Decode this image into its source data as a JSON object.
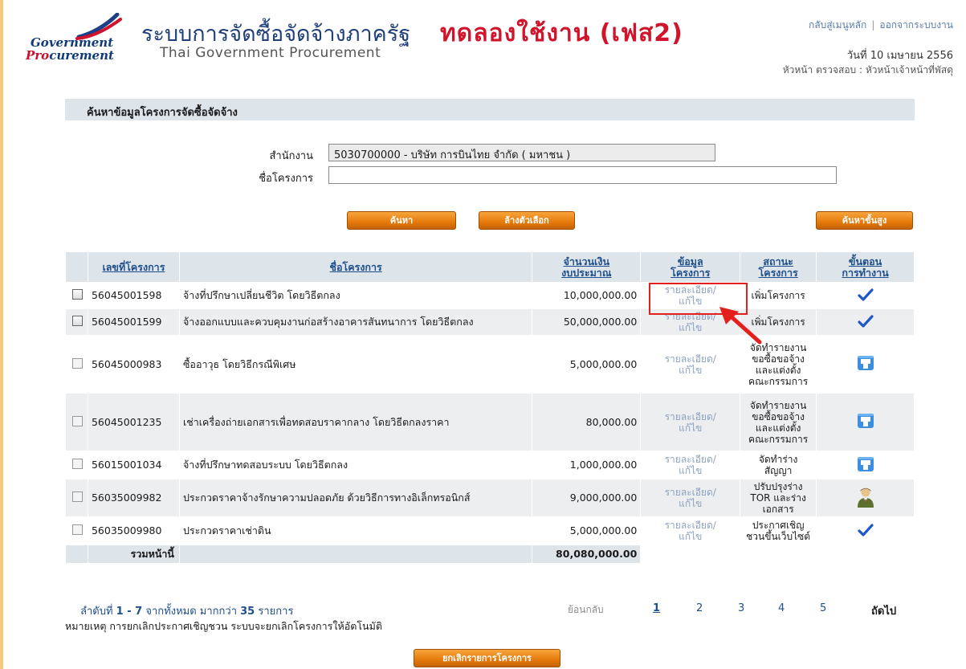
{
  "header": {
    "logo_word_1": "Government",
    "logo_word_2a": "P",
    "logo_word_2b": "ro",
    "logo_word_2c": "curement",
    "title_th": "ระบบการจัดซื้อจัดจ้างภาครัฐ",
    "trial_label": "ทดลองใช้งาน (เฟส2)",
    "subtitle_en": "Thai Government Procurement",
    "link_main_menu": "กลับสู่เมนูหลัก",
    "link_separator": "|",
    "link_logout": "ออกจากระบบงาน",
    "date_text": "วันที่ 10 เมษายน 2556",
    "role_text": "หัวหน้า ตรวจสอบ : หัวหน้าเจ้าหน้าที่พัสดุ"
  },
  "search": {
    "panel_title": "ค้นหาข้อมูลโครงการจัดซื้อจัดจ้าง",
    "office_label": "สำนักงาน",
    "office_value": "5030700000 - บริษัท การบินไทย จำกัด ( มหาชน )",
    "project_name_label": "ชื่อโครงการ",
    "project_name_value": "",
    "search_button": "ค้นหา",
    "clear_button": "ล้างตัวเลือก",
    "advanced_button": "ค้นหาขั้นสูง"
  },
  "table": {
    "columns": {
      "project_no": "เลขที่โครงการ",
      "project_name": "ชื่อโครงการ",
      "budget_line1": "จำนวนเงิน",
      "budget_line2": "งบประมาณ",
      "info_line1": "ข้อมูล",
      "info_line2": "โครงการ",
      "status_line1": "สถานะ",
      "status_line2": "โครงการ",
      "step_line1": "ขั้นตอน",
      "step_line2": "การทำงาน"
    },
    "rows": [
      {
        "no": "56045001598",
        "name": "จ้างที่ปรึกษาเปลี่ยนชีวิต โดยวิธีตกลง",
        "budget": "10,000,000.00",
        "link_line1": "รายละเอียด/",
        "link_line2": "แก้ไข",
        "status": "เพิ่มโครงการ",
        "step_icon": "checkmark-icon"
      },
      {
        "no": "56045001599",
        "name": "จ้างออกแบบและควบคุมงานก่อสร้างอาคารสันทนาการ โดยวิธีตกลง",
        "budget": "50,000,000.00",
        "link_line1": "รายละเอียด/",
        "link_line2": "แก้ไข",
        "status": "เพิ่มโครงการ",
        "step_icon": "checkmark-icon"
      },
      {
        "no": "56045000983",
        "name": "ซื้ออาวุธ โดยวิธีกรณีพิเศษ",
        "budget": "5,000,000.00",
        "link_line1": "รายละเอียด/",
        "link_line2": "แก้ไข",
        "status": "จัดทำรายงานขอซื้อขอจ้างและแต่งตั้งคณะกรรมการ",
        "step_icon": "truck-icon"
      },
      {
        "no": "56045001235",
        "name": "เช่าเครื่องถ่ายเอกสารเพื่อทดสอบราคากลาง โดยวิธีตกลงราคา",
        "budget": "80,000.00",
        "link_line1": "รายละเอียด/",
        "link_line2": "แก้ไข",
        "status": "จัดทำรายงานขอซื้อขอจ้างและแต่งตั้งคณะกรรมการ",
        "step_icon": "truck-icon"
      },
      {
        "no": "56015001034",
        "name": "จ้างที่ปรึกษาทดสอบระบบ โดยวิธีตกลง",
        "budget": "1,000,000.00",
        "link_line1": "รายละเอียด/",
        "link_line2": "แก้ไข",
        "status": "จัดทำร่างสัญญา",
        "step_icon": "truck-icon"
      },
      {
        "no": "56035009982",
        "name": "ประกวดราคาจ้างรักษาความปลอดภัย ด้วยวิธีการทางอิเล็กทรอนิกส์",
        "budget": "9,000,000.00",
        "link_line1": "รายละเอียด/",
        "link_line2": "แก้ไข",
        "status": "ปรับปรุงร่าง TOR และร่างเอกสาร",
        "step_icon": "person-icon"
      },
      {
        "no": "56035009980",
        "name": "ประกวดราคาเช่าดิน",
        "budget": "5,000,000.00",
        "link_line1": "รายละเอียด/",
        "link_line2": "แก้ไข",
        "status": "ประกาศเชิญชวนขึ้นเว็บไซต์",
        "step_icon": "checkmark-icon"
      }
    ],
    "status_lines": [
      [
        "เพิ่มโครงการ"
      ],
      [
        "เพิ่มโครงการ"
      ],
      [
        "จัดทำรายงาน",
        "ขอซื้อขอจ้าง",
        "และแต่งตั้ง",
        "คณะกรรมการ"
      ],
      [
        "จัดทำรายงาน",
        "ขอซื้อขอจ้าง",
        "และแต่งตั้ง",
        "คณะกรรมการ"
      ],
      [
        "จัดทำร่าง",
        "สัญญา"
      ],
      [
        "ปรับปรุงร่าง",
        "TOR และร่าง",
        "เอกสาร"
      ],
      [
        "ประกาศเชิญ",
        "ชวนขึ้นเว็บไซต์"
      ]
    ],
    "total_label": "รวมหน้านี้",
    "total_value": "80,080,000.00"
  },
  "pagination": {
    "summary_prefix": "ลำดับที่",
    "summary_range": "1 - 7",
    "summary_mid": "จากทั้งหมด มากกว่า",
    "summary_count": "35",
    "summary_suffix": "รายการ",
    "back": "ย้อนกลับ",
    "pages": [
      "1",
      "2",
      "3",
      "4",
      "5"
    ],
    "next": "ถัดไป"
  },
  "note": "หมายเหตุ การยกเลิกประกาศเชิญชวน ระบบจะยกเลิกโครงการให้อัตโนมัติ",
  "cancel_button": "ยกเลิกรายการโครงการ",
  "colors": {
    "accent_orange": "#e57a0c",
    "header_blue": "#1f4f8c",
    "trial_red": "#d0142b",
    "highlight_red": "#e3201b"
  }
}
